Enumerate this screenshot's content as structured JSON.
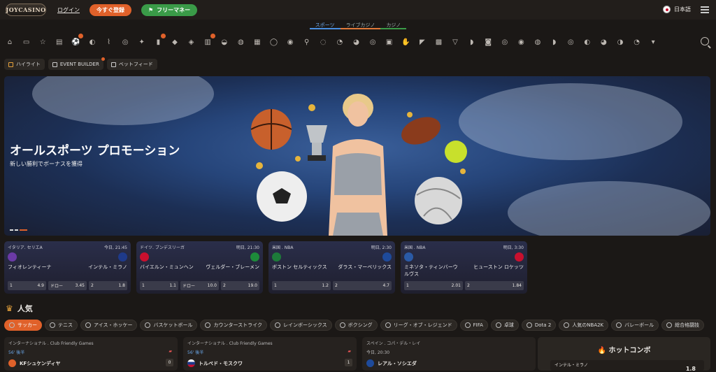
{
  "header": {
    "logo": "JOYCASINO",
    "login": "ログイン",
    "register": "今すぐ登録",
    "free_money": "フリーマネー",
    "language": "日本語"
  },
  "tabs": [
    "スポーツ",
    "ライブカジノ",
    "カジノ"
  ],
  "sport_icons": [
    "home-icon",
    "live-icon",
    "favorites-icon",
    "coupon-icon",
    "soccer-icon",
    "tennis-icon",
    "hockey-icon",
    "basketball-icon",
    "counter-strike-icon",
    "rainbow-six-icon",
    "boxing-icon",
    "lol-icon",
    "fifa-icon",
    "table-tennis-icon",
    "dota2-icon",
    "nba2k-icon",
    "volleyball-icon",
    "esports-icon",
    "cricket-icon",
    "baseball-icon",
    "handball-icon",
    "badminton-icon",
    "darts-icon",
    "fifa-icon-2",
    "mma-icon",
    "nba-icon",
    "fifa-penalty-icon",
    "valorant-icon",
    "nhl-icon",
    "nfl-icon",
    "american-football-icon",
    "cycling-icon",
    "rugby-icon",
    "beach-volleyball-icon",
    "snooker-icon",
    "golf-icon",
    "billiards-icon",
    "racing-icon",
    "field-hockey-icon",
    "more-icon"
  ],
  "subnav": {
    "highlights": "ハイライト",
    "event_builder": "EVENT BUILDER",
    "bet_feed": "ベットフィード"
  },
  "hero": {
    "title": "オールスポーツ プロモーション",
    "subtitle": "新しい勝利でボーナスを獲得"
  },
  "matches": [
    {
      "league": "イタリア. セリエA",
      "time": "今日, 21:45",
      "home": "フィオレンティーナ",
      "away": "インテル・ミラノ",
      "odds": [
        {
          "label": "1",
          "value": "4.9"
        },
        {
          "label": "ドロー",
          "value": "3.45"
        },
        {
          "label": "2",
          "value": "1.8"
        }
      ]
    },
    {
      "league": "ドイツ. ブンデスリーガ",
      "time": "明日, 21:30",
      "home": "バイエルン・ミュンヘン",
      "away": "ヴェルダー・ブレーメン",
      "odds": [
        {
          "label": "1",
          "value": "1.1"
        },
        {
          "label": "ドロー",
          "value": "10.0"
        },
        {
          "label": "2",
          "value": "19.0"
        }
      ]
    },
    {
      "league": "米国 . NBA",
      "time": "明日, 2:30",
      "home": "ボストン セルティックス",
      "away": "ダラス・マーベリックス",
      "odds": [
        {
          "label": "1",
          "value": "1.2"
        },
        {
          "label": "2",
          "value": "4.7"
        }
      ]
    },
    {
      "league": "米国 . NBA",
      "time": "明日, 3:30",
      "home": "ミネソタ・ティンバーウルヴス",
      "away": "ヒューストン ロケッツ",
      "odds": [
        {
          "label": "1",
          "value": "2.01"
        },
        {
          "label": "2",
          "value": "1.84"
        }
      ]
    }
  ],
  "popular": {
    "title": "人気",
    "filters": [
      "サッカー",
      "テニス",
      "アイス・ホッケー",
      "バスケットボール",
      "カウンターストライク",
      "レインボーシックス",
      "ボクシング",
      "リーグ・オブ・レジェンド",
      "FIFA",
      "卓球",
      "Dota 2",
      "人気のNBA2K",
      "バレーボール",
      "総合格闘技"
    ]
  },
  "games": [
    {
      "league": "インターナショナル . Club Friendly Games",
      "time": "56' 後半",
      "team": "KFシュケンディヤ",
      "score": "0"
    },
    {
      "league": "インターナショナル . Club Friendly Games",
      "time": "56' 後半",
      "team": "トルペド・モスクワ",
      "score": "1"
    },
    {
      "league": "スペイン . コパ・デル・レイ",
      "time": "今日, 20:30",
      "team": "レアル・ソシエダ",
      "score": ""
    }
  ],
  "hot_combo": {
    "title": "ホットコンボ",
    "team": "インテル・ミラノ",
    "odd": "1.8"
  },
  "colors": {
    "accent": "#e0612a",
    "green": "#3a9b48",
    "blue": "#4a8fe0"
  }
}
